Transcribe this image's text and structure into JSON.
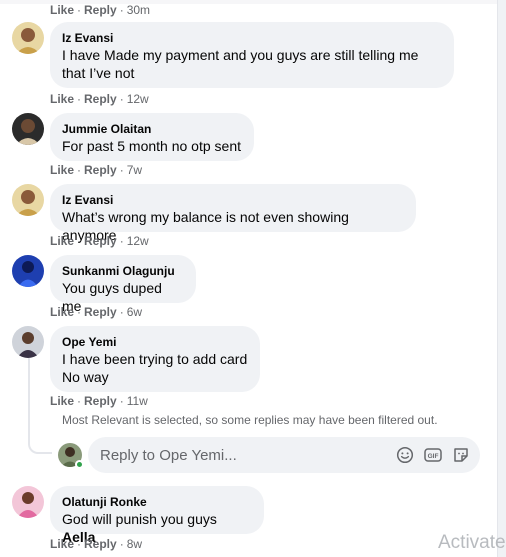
{
  "actions": {
    "like": "Like",
    "reply": "Reply",
    "separator": "·"
  },
  "comments": [
    {
      "time": "30m"
    },
    {
      "author": "Iz Evansi",
      "text": "I have Made my payment and you guys are still telling me\nthat I’ve not",
      "time": "12w",
      "avatar_color": "#c9a04a"
    },
    {
      "author": "Jummie Olaitan",
      "text": "For past 5 month no otp sent",
      "time": "7w",
      "avatar_color": "#3a3a3a"
    },
    {
      "author": "Iz Evansi",
      "text": "What’s wrong my balance is not even showing anymore",
      "time": "12w",
      "avatar_color": "#c9a04a"
    },
    {
      "author": "Sunkanmi Olagunju",
      "text": "You guys duped me",
      "time": "6w",
      "avatar_color": "#2d5bd6"
    },
    {
      "author": "Ope Yemi",
      "text": "I have been trying to add card\nNo way",
      "time": "11w",
      "avatar_color": "#4a3f52"
    },
    {
      "author": "Olatunji Ronke",
      "text_prefix": "God will punish you guys ",
      "text_bold": "Aella",
      "time": "8w",
      "avatar_color": "#e26aa0"
    }
  ],
  "filtered_notice": "Most Relevant is selected, so some replies may have been filtered out.",
  "reply_box": {
    "placeholder": "Reply to Ope Yemi...",
    "icons": [
      "emoji-icon",
      "gif-icon",
      "sticker-icon"
    ],
    "avatar_color": "#5a6b4a"
  },
  "watermark": "Activate"
}
